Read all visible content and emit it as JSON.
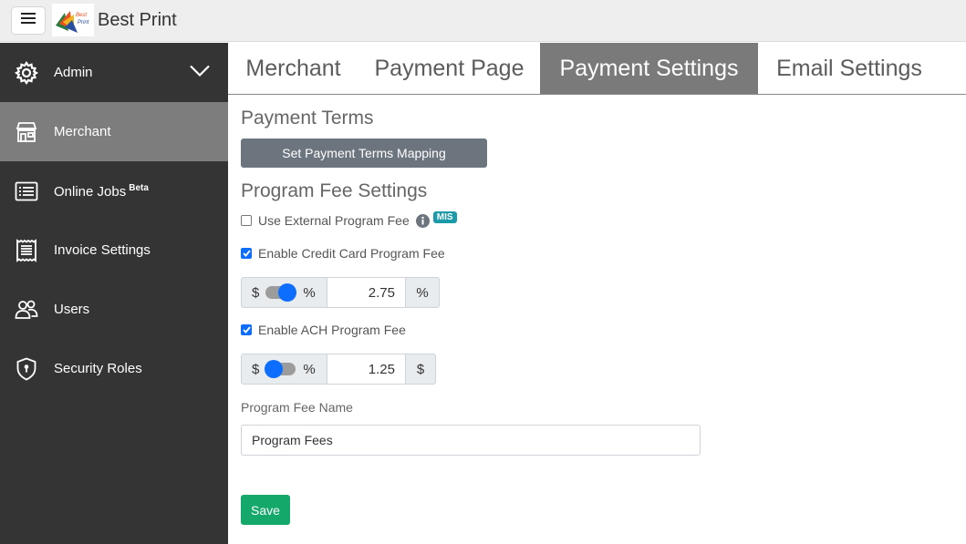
{
  "app": {
    "title": "Best Print",
    "logo_text": "Best Print"
  },
  "sidebar": {
    "admin_label": "Admin",
    "items": [
      {
        "label": "Merchant",
        "icon": "store-icon",
        "active": true
      },
      {
        "label": "Online Jobs",
        "badge": "Beta",
        "icon": "list-icon"
      },
      {
        "label": "Invoice Settings",
        "icon": "invoice-icon"
      },
      {
        "label": "Users",
        "icon": "users-icon"
      },
      {
        "label": "Security Roles",
        "icon": "shield-icon"
      }
    ]
  },
  "tabs": [
    {
      "label": "Merchant"
    },
    {
      "label": "Payment Page"
    },
    {
      "label": "Payment Settings",
      "active": true
    },
    {
      "label": "Email Settings"
    }
  ],
  "payment_terms": {
    "title": "Payment Terms",
    "button_label": "Set Payment Terms Mapping"
  },
  "program_fee": {
    "title": "Program Fee Settings",
    "use_external": {
      "label": "Use External Program Fee",
      "checked": false,
      "badge": "MIS"
    },
    "credit_card": {
      "label": "Enable Credit Card Program Fee",
      "checked": true,
      "toggle_left": "$",
      "toggle_right": "%",
      "value": "2.75",
      "unit": "%"
    },
    "ach": {
      "label": "Enable ACH Program Fee",
      "checked": true,
      "toggle_left": "$",
      "toggle_right": "%",
      "value": "1.25",
      "unit": "$"
    },
    "name_label": "Program Fee Name",
    "name_value": "Program Fees"
  },
  "save_label": "Save",
  "colors": {
    "sidebar_bg": "#343434",
    "sidebar_active": "#7d7d7d",
    "tab_active": "#7a7a7a",
    "primary": "#0d6efd",
    "save_green": "#15a86b",
    "badge_teal": "#1b9aaa"
  }
}
